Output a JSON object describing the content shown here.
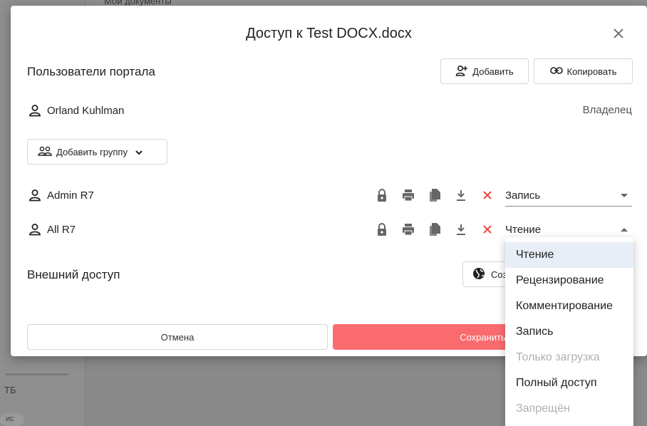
{
  "background": {
    "top_text": "Мои документы",
    "left_text": "ТБ",
    "pill_text": "ис"
  },
  "dialog": {
    "title": "Доступ к Test DOCX.docx",
    "close_icon": "close-icon",
    "portal_users_title": "Пользователи портала",
    "add_button_label": "Добавить",
    "copy_button_label": "Копировать",
    "owner": {
      "name": "Orland Kuhlman",
      "role": "Владелец"
    },
    "add_group_label": "Добавить группу",
    "users": [
      {
        "name": "Admin R7",
        "access": "Запись"
      },
      {
        "name": "All R7",
        "access": "Чтение"
      }
    ],
    "external_access_title": "Внешний доступ",
    "external_button_label": "Создать",
    "cancel_label": "Отмена",
    "save_label": "Сохранить"
  },
  "access_menu": {
    "items": [
      {
        "label": "Чтение",
        "selected": true,
        "disabled": false
      },
      {
        "label": "Рецензирование",
        "selected": false,
        "disabled": false
      },
      {
        "label": "Комментирование",
        "selected": false,
        "disabled": false
      },
      {
        "label": "Запись",
        "selected": false,
        "disabled": false
      },
      {
        "label": "Только загрузка",
        "selected": false,
        "disabled": true
      },
      {
        "label": "Полный доступ",
        "selected": false,
        "disabled": false
      },
      {
        "label": "Запрещён",
        "selected": false,
        "disabled": true
      }
    ]
  },
  "colors": {
    "save_button": "#fa6b6f",
    "delete_icon": "#f0473f",
    "selected_item": "#e8eef7"
  }
}
